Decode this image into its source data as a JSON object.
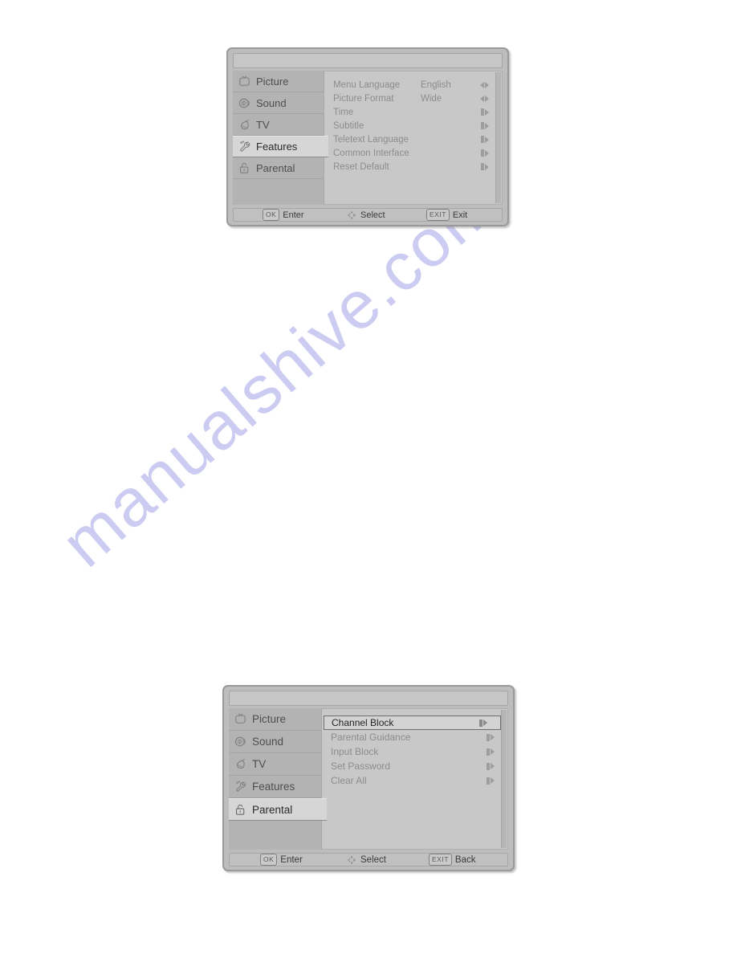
{
  "watermark": {
    "text": "manualshive.com",
    "color": "#ccccf2"
  },
  "panels": [
    {
      "id": "features",
      "title": "",
      "sidebar": [
        {
          "label": "Picture",
          "icon": "tv-picture-icon",
          "selected": false
        },
        {
          "label": "Sound",
          "icon": "speaker-icon",
          "selected": false
        },
        {
          "label": "TV",
          "icon": "satellite-dish-icon",
          "selected": false
        },
        {
          "label": "Features",
          "icon": "wrench-icon",
          "selected": true
        },
        {
          "label": "Parental",
          "icon": "padlock-icon",
          "selected": false
        }
      ],
      "options": [
        {
          "label": "Menu Language",
          "value": "English",
          "arrow": "left-right",
          "highlight": false
        },
        {
          "label": "Picture Format",
          "value": "Wide",
          "arrow": "left-right",
          "highlight": false
        },
        {
          "label": "Time",
          "value": "",
          "arrow": "enter",
          "highlight": false
        },
        {
          "label": "Subtitle",
          "value": "",
          "arrow": "enter",
          "highlight": false
        },
        {
          "label": "Teletext Language",
          "value": "",
          "arrow": "enter",
          "highlight": false
        },
        {
          "label": "Common Interface",
          "value": "",
          "arrow": "enter",
          "highlight": false
        },
        {
          "label": "Reset Default",
          "value": "",
          "arrow": "enter",
          "highlight": false
        }
      ],
      "footer": [
        {
          "key": "OK",
          "label": "Enter",
          "icon": ""
        },
        {
          "key": "",
          "label": "Select",
          "icon": "dpad-icon"
        },
        {
          "key": "EXIT",
          "label": "Exit",
          "icon": ""
        }
      ]
    },
    {
      "id": "parental",
      "title": "",
      "sidebar": [
        {
          "label": "Picture",
          "icon": "tv-picture-icon",
          "selected": false
        },
        {
          "label": "Sound",
          "icon": "speaker-icon",
          "selected": false
        },
        {
          "label": "TV",
          "icon": "satellite-dish-icon",
          "selected": false
        },
        {
          "label": "Features",
          "icon": "wrench-icon",
          "selected": false
        },
        {
          "label": "Parental",
          "icon": "padlock-icon",
          "selected": true
        }
      ],
      "options": [
        {
          "label": "Channel Block",
          "value": "",
          "arrow": "enter",
          "highlight": true
        },
        {
          "label": "Parental Guidance",
          "value": "",
          "arrow": "enter",
          "highlight": false
        },
        {
          "label": "Input Block",
          "value": "",
          "arrow": "enter",
          "highlight": false
        },
        {
          "label": "Set Password",
          "value": "",
          "arrow": "enter",
          "highlight": false
        },
        {
          "label": "Clear All",
          "value": "",
          "arrow": "enter",
          "highlight": false
        }
      ],
      "footer": [
        {
          "key": "OK",
          "label": "Enter",
          "icon": ""
        },
        {
          "key": "",
          "label": "Select",
          "icon": "dpad-icon"
        },
        {
          "key": "EXIT",
          "label": "Back",
          "icon": ""
        }
      ]
    }
  ]
}
